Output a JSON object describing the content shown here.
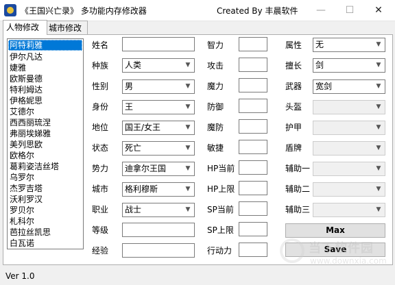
{
  "window": {
    "title": "《王国兴亡录》 多功能内存修改器",
    "created_by": "Created By 丰晨软件",
    "minimize_glyph": "—",
    "maximize_glyph": "☐",
    "close_glyph": "✕"
  },
  "tabs": [
    "人物修改",
    "城市修改"
  ],
  "character_list": {
    "items": [
      "阿特莉雅",
      "伊尔凡达",
      "婕雅",
      "欧斯曼德",
      "特利姆达",
      "伊格妮思",
      "艾德尔",
      "西西丽琉涅",
      "弗丽埃娣雅",
      "美列思欧",
      "欧格尔",
      "葛莉姿洁丝塔",
      "乌罗尔",
      "杰罗吉塔",
      "沃利罗汉",
      "罗贝尔",
      "札科尔",
      "芭拉丝凯思",
      "白瓦诺"
    ],
    "selected": 0
  },
  "col1": {
    "name_label": "姓名",
    "name_value": "",
    "race_label": "种族",
    "race_value": "人类",
    "gender_label": "性别",
    "gender_value": "男",
    "identity_label": "身份",
    "identity_value": "王",
    "position_label": "地位",
    "position_value": "国王/女王",
    "state_label": "状态",
    "state_value": "死亡",
    "faction_label": "势力",
    "faction_value": "迪拿尔王国",
    "city_label": "城市",
    "city_value": "格利穆斯",
    "job_label": "职业",
    "job_value": "战士",
    "level_label": "等级",
    "level_value": "",
    "exp_label": "经验",
    "exp_value": ""
  },
  "col2": {
    "int_label": "智力",
    "int_value": "",
    "atk_label": "攻击",
    "atk_value": "",
    "mag_label": "魔力",
    "mag_value": "",
    "def_label": "防御",
    "def_value": "",
    "mdef_label": "魔防",
    "mdef_value": "",
    "agi_label": "敏捷",
    "agi_value": "",
    "hp_cur_label": "HP当前",
    "hp_cur_value": "",
    "hp_max_label": "HP上限",
    "hp_max_value": "",
    "sp_cur_label": "SP当前",
    "sp_cur_value": "",
    "sp_max_label": "SP上限",
    "sp_max_value": "",
    "ap_label": "行动力",
    "ap_value": ""
  },
  "col3": {
    "attr_label": "属性",
    "attr_value": "无",
    "skill_label": "擅长",
    "skill_value": "剑",
    "weapon_label": "武器",
    "weapon_value": "宽剑",
    "helmet_label": "头盔",
    "helmet_value": "",
    "armor_label": "护甲",
    "armor_value": "",
    "shield_label": "盾牌",
    "shield_value": "",
    "aux1_label": "辅助一",
    "aux1_value": "",
    "aux2_label": "辅助二",
    "aux2_value": "",
    "aux3_label": "辅助三",
    "aux3_value": "",
    "max_button": "Max",
    "save_button": "Save"
  },
  "status": {
    "version": "Ver 1.0"
  },
  "watermark": {
    "text": "当下软件园",
    "url": "www.downxia.com"
  },
  "icons": {
    "combo_arrow": "chevron-down-icon",
    "app": "app-emblem-icon"
  }
}
